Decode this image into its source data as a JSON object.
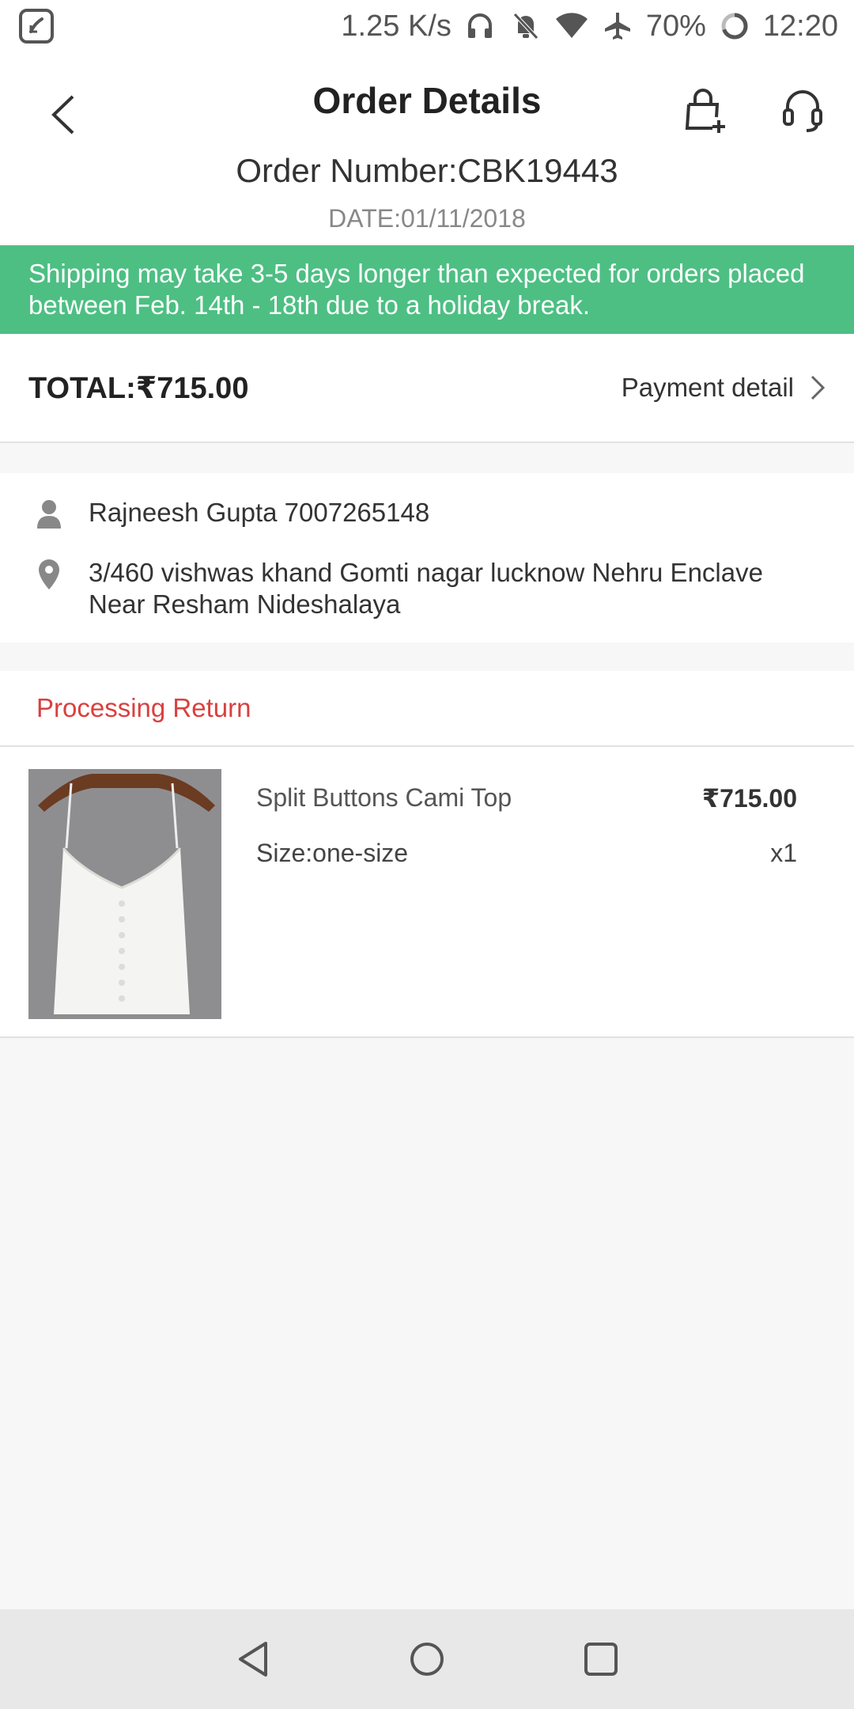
{
  "status_bar": {
    "network_speed": "1.25 K/s",
    "battery": "70%",
    "time": "12:20",
    "icons": [
      "saavn-app-icon",
      "headphones-icon",
      "mute-icon",
      "wifi-icon",
      "airplane-icon",
      "battery-ring-icon"
    ]
  },
  "header": {
    "title": "Order Details",
    "order_number": "Order Number:CBK19443",
    "date": "DATE:01/11/2018",
    "icons": [
      "back-arrow-icon",
      "add-to-cart-icon",
      "headset-support-icon"
    ]
  },
  "banner": {
    "text": "Shipping may take 3-5 days longer than expected for orders placed between Feb. 14th - 18th due to a holiday break.",
    "color": "#4dbf83"
  },
  "summary": {
    "total": "TOTAL:₹715.00",
    "payment_link": "Payment detail"
  },
  "address": {
    "contact": "Rajneesh Gupta  7007265148",
    "location": "3/460 vishwas khand Gomti nagar lucknow Nehru Enclave Near Resham Nideshalaya"
  },
  "order_status": {
    "label": "Processing Return",
    "color": "#d9403f"
  },
  "item": {
    "name": "Split Buttons Cami Top",
    "price": "₹715.00",
    "size": "Size:one-size",
    "quantity": "x1"
  },
  "nav_bar": {
    "icons": [
      "nav-back-icon",
      "nav-home-icon",
      "nav-recents-icon"
    ]
  }
}
